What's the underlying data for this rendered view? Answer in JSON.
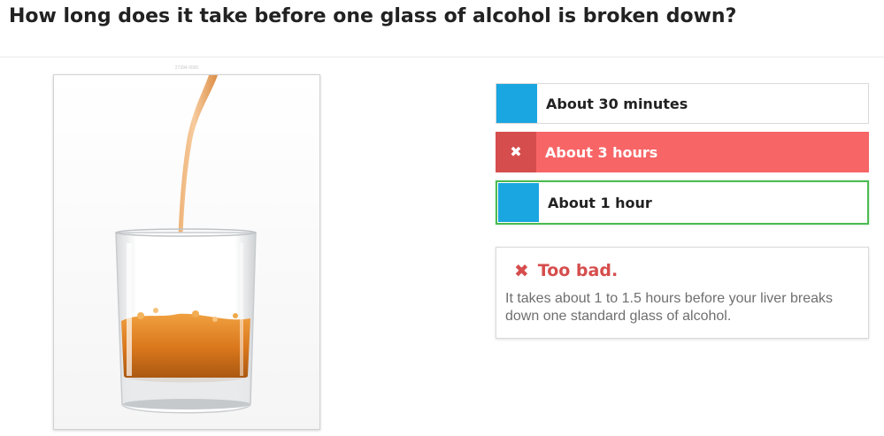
{
  "question": {
    "title": "How long does it take before one glass of alcohol is broken down?"
  },
  "image": {
    "caption": "27394 0000",
    "description_icon": "whiskey-glass-pour-photo"
  },
  "options": [
    {
      "label": "About 30 minutes",
      "state": "neutral",
      "marker_color": "#1aa6e0"
    },
    {
      "label": "About 3 hours",
      "state": "selected-wrong",
      "marker_icon": "✖",
      "background": "#f76566",
      "marker_color": "#d64d4d"
    },
    {
      "label": "About 1 hour",
      "state": "correct",
      "border_color": "#4cbb53",
      "marker_color": "#1aa6e0"
    }
  ],
  "feedback": {
    "icon": "✖",
    "heading": "Too bad.",
    "text": "It takes about 1 to 1.5 hours before your liver breaks down one standard glass of alcohol.",
    "heading_color": "#d64d4d"
  }
}
